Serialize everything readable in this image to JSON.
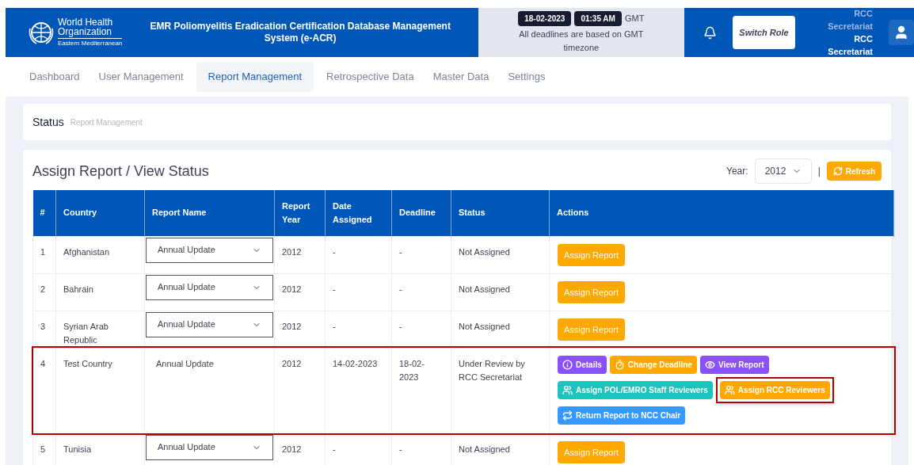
{
  "header": {
    "logo_lines": [
      "World Health",
      "Organization",
      "Eastern Mediterranean"
    ],
    "title": "EMR Poliomyelitis Eradication Certification Database Management System (e-ACR)",
    "date": "18-02-2023",
    "time": "01:35 AM",
    "timezone": "GMT",
    "note": "All deadlines are based on GMT timezone",
    "switch_role": "Switch Role",
    "user_role": "RCC Secretariat",
    "user_name": "RCC Secretariat"
  },
  "nav": [
    {
      "label": "Dashboard",
      "selected": false
    },
    {
      "label": "User Management",
      "selected": false
    },
    {
      "label": "Report Management",
      "selected": true
    },
    {
      "label": "Retrospective Data",
      "selected": false
    },
    {
      "label": "Master Data",
      "selected": false
    },
    {
      "label": "Settings",
      "selected": false
    }
  ],
  "breadcrumb": {
    "title": "Status",
    "path": "Report Management"
  },
  "card": {
    "title": "Assign Report / View Status",
    "year_label": "Year:",
    "year_value": "2012",
    "separator": "|",
    "refresh": "Refresh"
  },
  "table": {
    "columns": [
      "#",
      "Country",
      "Report Name",
      "Report Year",
      "Date Assigned",
      "Deadline",
      "Status",
      "Actions"
    ],
    "rows": [
      {
        "number": "1",
        "country": "Afghanistan",
        "report_name": "Annual Update",
        "kind": "select",
        "year": "2012",
        "date_assigned": "-",
        "deadline": "-",
        "status": "Not Assigned",
        "highlighted": false,
        "actions": [
          {
            "label": "Assign Report",
            "kind": "plain",
            "color": "#ffa800",
            "highlighted": false
          }
        ]
      },
      {
        "number": "2",
        "country": "Bahrain",
        "report_name": "Annual Update",
        "kind": "select",
        "year": "2012",
        "date_assigned": "-",
        "deadline": "-",
        "status": "Not Assigned",
        "highlighted": false,
        "actions": [
          {
            "label": "Assign Report",
            "kind": "plain",
            "color": "#ffa800",
            "highlighted": false
          }
        ]
      },
      {
        "number": "3",
        "country": "Syrian Arab Republic",
        "report_name": "Annual Update",
        "kind": "select",
        "year": "2012",
        "date_assigned": "-",
        "deadline": "-",
        "status": "Not Assigned",
        "highlighted": false,
        "actions": [
          {
            "label": "Assign Report",
            "kind": "plain",
            "color": "#ffa800",
            "highlighted": false
          }
        ]
      },
      {
        "number": "4",
        "country": "Test Country",
        "report_name": "Annual Update",
        "kind": "text",
        "year": "2012",
        "date_assigned": "14-02-2023",
        "deadline": "18-02-2023",
        "status": "Under Review by RCC Secretariat",
        "highlighted": true,
        "actions": [
          {
            "label": "Details",
            "kind": "info",
            "color": "#8950fc",
            "highlighted": false
          },
          {
            "label": "Change Deadline",
            "kind": "timer",
            "color": "#ffa800",
            "highlighted": false
          },
          {
            "label": "View Report",
            "kind": "eye",
            "color": "#8950fc",
            "highlighted": false
          },
          {
            "label": "Assign POL/EMRO Staff Reviewers",
            "kind": "users",
            "color": "#1bc5bd",
            "highlighted": false
          },
          {
            "label": "Assign RCC Reviewers",
            "kind": "users",
            "color": "#ffa800",
            "highlighted": true
          },
          {
            "label": "Return Report to NCC Chair",
            "kind": "return",
            "color": "#3699ff",
            "highlighted": false
          }
        ]
      },
      {
        "number": "5",
        "country": "Tunisia",
        "report_name": "Annual Update",
        "kind": "select",
        "year": "2012",
        "date_assigned": "-",
        "deadline": "-",
        "status": "Not Assigned",
        "highlighted": false,
        "actions": [
          {
            "label": "Assign Report",
            "kind": "plain",
            "color": "#ffa800",
            "highlighted": false
          }
        ]
      }
    ]
  }
}
